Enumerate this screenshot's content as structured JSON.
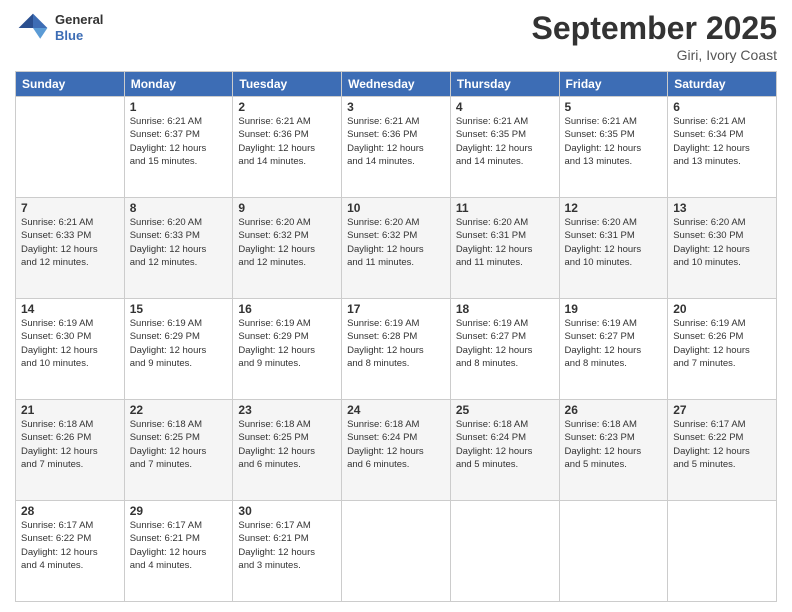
{
  "header": {
    "logo_general": "General",
    "logo_blue": "Blue",
    "month": "September 2025",
    "location": "Giri, Ivory Coast"
  },
  "days_of_week": [
    "Sunday",
    "Monday",
    "Tuesday",
    "Wednesday",
    "Thursday",
    "Friday",
    "Saturday"
  ],
  "weeks": [
    [
      {
        "day": "",
        "info": ""
      },
      {
        "day": "1",
        "info": "Sunrise: 6:21 AM\nSunset: 6:37 PM\nDaylight: 12 hours\nand 15 minutes."
      },
      {
        "day": "2",
        "info": "Sunrise: 6:21 AM\nSunset: 6:36 PM\nDaylight: 12 hours\nand 14 minutes."
      },
      {
        "day": "3",
        "info": "Sunrise: 6:21 AM\nSunset: 6:36 PM\nDaylight: 12 hours\nand 14 minutes."
      },
      {
        "day": "4",
        "info": "Sunrise: 6:21 AM\nSunset: 6:35 PM\nDaylight: 12 hours\nand 14 minutes."
      },
      {
        "day": "5",
        "info": "Sunrise: 6:21 AM\nSunset: 6:35 PM\nDaylight: 12 hours\nand 13 minutes."
      },
      {
        "day": "6",
        "info": "Sunrise: 6:21 AM\nSunset: 6:34 PM\nDaylight: 12 hours\nand 13 minutes."
      }
    ],
    [
      {
        "day": "7",
        "info": "Sunrise: 6:21 AM\nSunset: 6:33 PM\nDaylight: 12 hours\nand 12 minutes."
      },
      {
        "day": "8",
        "info": "Sunrise: 6:20 AM\nSunset: 6:33 PM\nDaylight: 12 hours\nand 12 minutes."
      },
      {
        "day": "9",
        "info": "Sunrise: 6:20 AM\nSunset: 6:32 PM\nDaylight: 12 hours\nand 12 minutes."
      },
      {
        "day": "10",
        "info": "Sunrise: 6:20 AM\nSunset: 6:32 PM\nDaylight: 12 hours\nand 11 minutes."
      },
      {
        "day": "11",
        "info": "Sunrise: 6:20 AM\nSunset: 6:31 PM\nDaylight: 12 hours\nand 11 minutes."
      },
      {
        "day": "12",
        "info": "Sunrise: 6:20 AM\nSunset: 6:31 PM\nDaylight: 12 hours\nand 10 minutes."
      },
      {
        "day": "13",
        "info": "Sunrise: 6:20 AM\nSunset: 6:30 PM\nDaylight: 12 hours\nand 10 minutes."
      }
    ],
    [
      {
        "day": "14",
        "info": "Sunrise: 6:19 AM\nSunset: 6:30 PM\nDaylight: 12 hours\nand 10 minutes."
      },
      {
        "day": "15",
        "info": "Sunrise: 6:19 AM\nSunset: 6:29 PM\nDaylight: 12 hours\nand 9 minutes."
      },
      {
        "day": "16",
        "info": "Sunrise: 6:19 AM\nSunset: 6:29 PM\nDaylight: 12 hours\nand 9 minutes."
      },
      {
        "day": "17",
        "info": "Sunrise: 6:19 AM\nSunset: 6:28 PM\nDaylight: 12 hours\nand 8 minutes."
      },
      {
        "day": "18",
        "info": "Sunrise: 6:19 AM\nSunset: 6:27 PM\nDaylight: 12 hours\nand 8 minutes."
      },
      {
        "day": "19",
        "info": "Sunrise: 6:19 AM\nSunset: 6:27 PM\nDaylight: 12 hours\nand 8 minutes."
      },
      {
        "day": "20",
        "info": "Sunrise: 6:19 AM\nSunset: 6:26 PM\nDaylight: 12 hours\nand 7 minutes."
      }
    ],
    [
      {
        "day": "21",
        "info": "Sunrise: 6:18 AM\nSunset: 6:26 PM\nDaylight: 12 hours\nand 7 minutes."
      },
      {
        "day": "22",
        "info": "Sunrise: 6:18 AM\nSunset: 6:25 PM\nDaylight: 12 hours\nand 7 minutes."
      },
      {
        "day": "23",
        "info": "Sunrise: 6:18 AM\nSunset: 6:25 PM\nDaylight: 12 hours\nand 6 minutes."
      },
      {
        "day": "24",
        "info": "Sunrise: 6:18 AM\nSunset: 6:24 PM\nDaylight: 12 hours\nand 6 minutes."
      },
      {
        "day": "25",
        "info": "Sunrise: 6:18 AM\nSunset: 6:24 PM\nDaylight: 12 hours\nand 5 minutes."
      },
      {
        "day": "26",
        "info": "Sunrise: 6:18 AM\nSunset: 6:23 PM\nDaylight: 12 hours\nand 5 minutes."
      },
      {
        "day": "27",
        "info": "Sunrise: 6:17 AM\nSunset: 6:22 PM\nDaylight: 12 hours\nand 5 minutes."
      }
    ],
    [
      {
        "day": "28",
        "info": "Sunrise: 6:17 AM\nSunset: 6:22 PM\nDaylight: 12 hours\nand 4 minutes."
      },
      {
        "day": "29",
        "info": "Sunrise: 6:17 AM\nSunset: 6:21 PM\nDaylight: 12 hours\nand 4 minutes."
      },
      {
        "day": "30",
        "info": "Sunrise: 6:17 AM\nSunset: 6:21 PM\nDaylight: 12 hours\nand 3 minutes."
      },
      {
        "day": "",
        "info": ""
      },
      {
        "day": "",
        "info": ""
      },
      {
        "day": "",
        "info": ""
      },
      {
        "day": "",
        "info": ""
      }
    ]
  ]
}
